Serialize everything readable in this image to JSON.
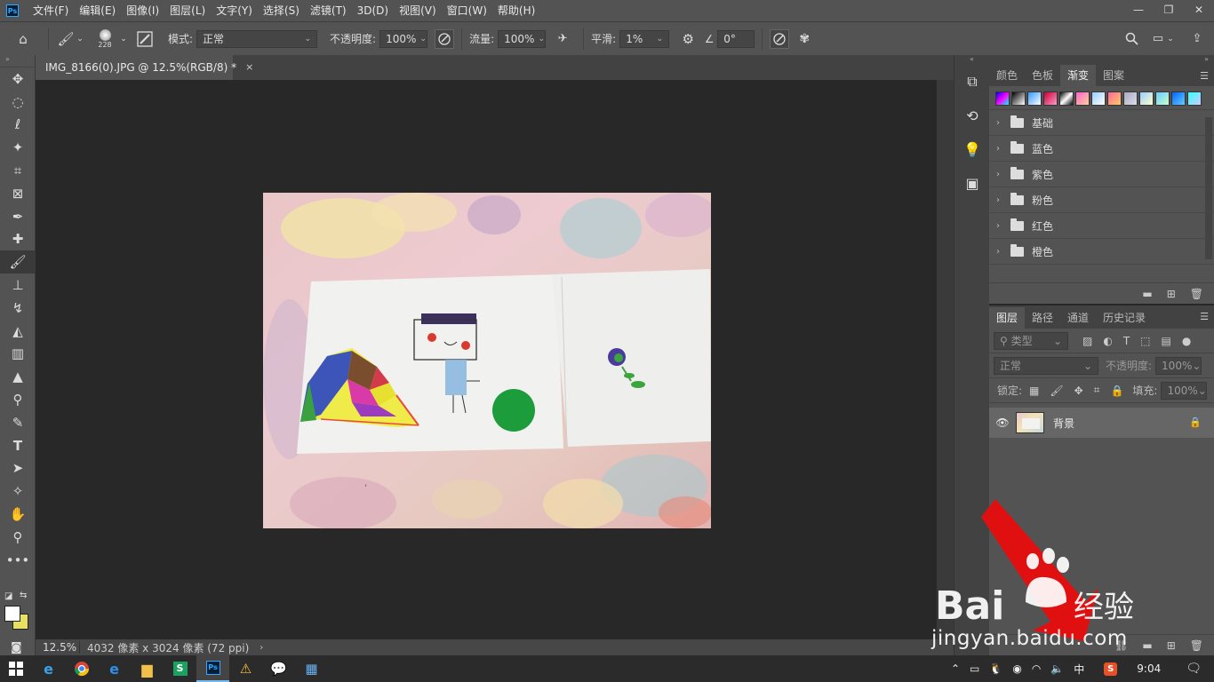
{
  "app": {
    "logo": "Ps"
  },
  "menubar": {
    "items": [
      "文件(F)",
      "编辑(E)",
      "图像(I)",
      "图层(L)",
      "文字(Y)",
      "选择(S)",
      "滤镜(T)",
      "3D(D)",
      "视图(V)",
      "窗口(W)",
      "帮助(H)"
    ],
    "window_controls": {
      "minimize": "—",
      "restore": "❐",
      "close": "✕"
    }
  },
  "options": {
    "brush_size": "228",
    "mode_label": "模式:",
    "mode_value": "正常",
    "opacity_label": "不透明度:",
    "opacity_value": "100%",
    "flow_label": "流量:",
    "flow_value": "100%",
    "smoothing_label": "平滑:",
    "smoothing_value": "1%",
    "angle_value": "0°"
  },
  "document": {
    "tab_title": "IMG_8166(0).JPG @ 12.5%(RGB/8) *",
    "close": "×",
    "zoom": "12.5%",
    "info": "4032 像素 x 3024 像素 (72 ppi)"
  },
  "gradient_panel": {
    "tabs": [
      "颜色",
      "色板",
      "渐变",
      "图案"
    ],
    "active_tab": 2,
    "folders": [
      "基础",
      "蓝色",
      "紫色",
      "粉色",
      "红色",
      "橙色"
    ]
  },
  "layers_panel": {
    "tabs": [
      "图层",
      "路径",
      "通道",
      "历史记录"
    ],
    "active_tab": 0,
    "filter_placeholder": "类型",
    "blend_mode": "正常",
    "opacity_label": "不透明度:",
    "opacity_value": "100%",
    "lock_label": "锁定:",
    "fill_label": "填充:",
    "fill_value": "100%",
    "layers": [
      {
        "name": "背景",
        "visible": true,
        "locked": true
      }
    ]
  },
  "watermark": {
    "brand": "Bai",
    "suffix": "经验",
    "url": "jingyan.baidu.com"
  },
  "taskbar": {
    "clock": "9:04",
    "ime": "中"
  },
  "colors": {
    "menubar_bg": "#535353",
    "canvas_bg": "#282828",
    "ps_blue": "#31a8ff",
    "foreground_swatch": "#ffffff",
    "background_swatch": "#e8e060",
    "watermark_arrow": "#e01010"
  }
}
